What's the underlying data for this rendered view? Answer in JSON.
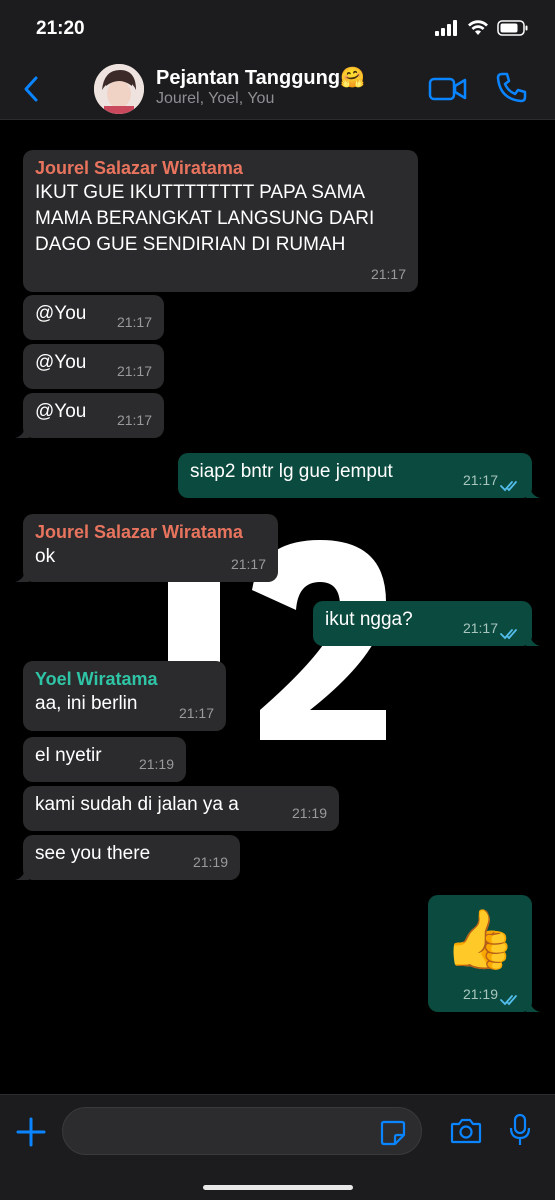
{
  "status_bar": {
    "time": "21:20"
  },
  "header": {
    "title": "Pejantan Tanggung🤗",
    "members": "Jourel, Yoel, You"
  },
  "input": {
    "placeholder": ""
  },
  "messages": [
    {
      "sender": "Jourel Salazar Wiratama",
      "sender_color": "#e8745e",
      "text": "IKUT GUE IKUTTTTTTTT PAPA SAMA\nMAMA BERANGKAT LANGSUNG DARI\nDAGO GUE SENDIRIAN DI RUMAH",
      "time": "21:17"
    },
    {
      "text": "@You",
      "time": "21:17"
    },
    {
      "text": "@You",
      "time": "21:17"
    },
    {
      "text": "@You",
      "time": "21:17"
    },
    {
      "text": "siap2 bntr lg gue jemput",
      "time": "21:17",
      "outgoing": true,
      "read": true
    },
    {
      "sender": "Jourel Salazar Wiratama",
      "sender_color": "#e8745e",
      "text": "ok",
      "time": "21:17"
    },
    {
      "text": "ikut ngga?",
      "time": "21:17",
      "outgoing": true,
      "read": true
    },
    {
      "sender": "Yoel Wiratama",
      "sender_color": "#2ec4a5",
      "text": "aa, ini berlin",
      "time": "21:17"
    },
    {
      "text": "el nyetir",
      "time": "21:19"
    },
    {
      "text": "kami sudah di jalan ya a",
      "time": "21:19"
    },
    {
      "text": "see you there",
      "time": "21:19"
    },
    {
      "text": "👍",
      "time": "21:19",
      "outgoing": true,
      "read": true
    }
  ],
  "colors": {
    "accent": "#0a84ff",
    "outgoing_bubble": "#0b4a3e",
    "incoming_bubble": "#2b2b2d",
    "read_check": "#53bdeb"
  }
}
